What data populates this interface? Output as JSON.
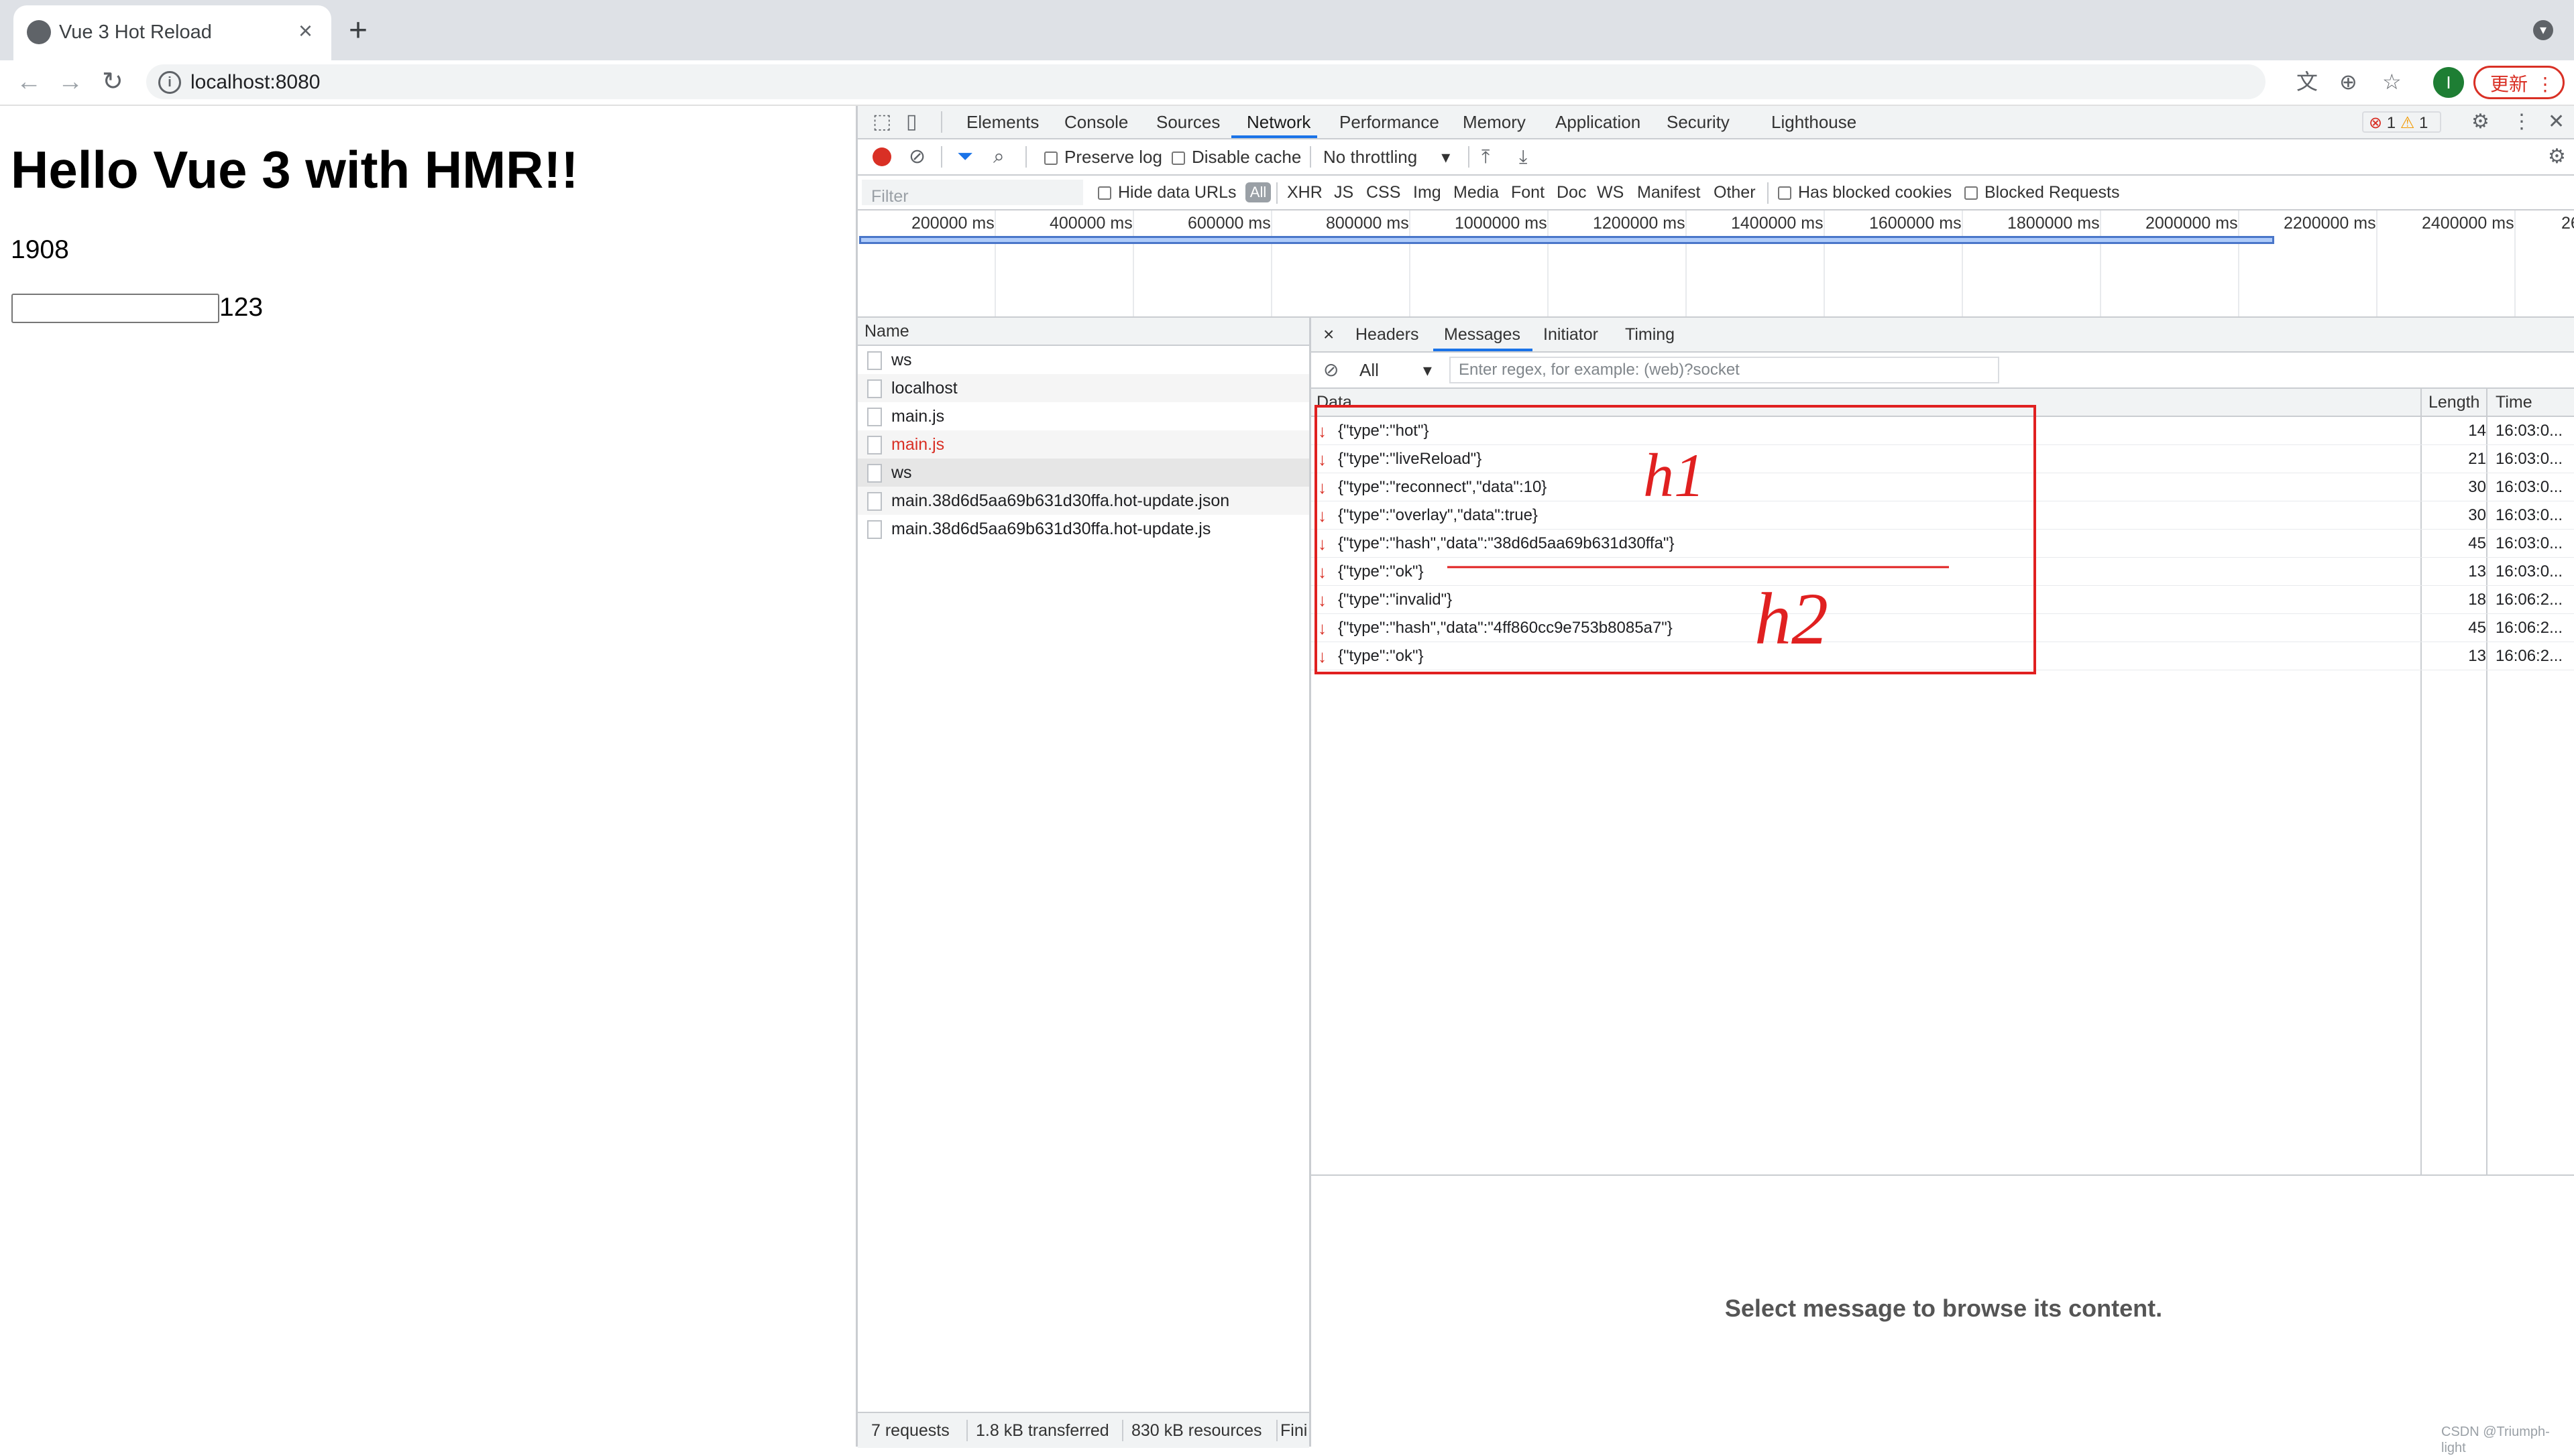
{
  "browser": {
    "tab_title": "Vue 3 Hot Reload",
    "tab_close": "×",
    "new_tab": "+",
    "url": "localhost:8080",
    "info_icon": "i",
    "back": "←",
    "forward": "→",
    "reload": "↻",
    "profile_initial": "I",
    "update_label": "更新",
    "menu_dots": "⋮",
    "translate_icon": "文",
    "zoom_icon": "⊕",
    "star_icon": "☆",
    "tab_search_icon": "▾"
  },
  "page": {
    "heading": "Hello Vue 3 with HMR!!",
    "counter": "1908",
    "input_value": "",
    "input_echo": "123"
  },
  "devtools": {
    "tabs": [
      "Elements",
      "Console",
      "Sources",
      "Network",
      "Performance",
      "Memory",
      "Application",
      "Security",
      "Lighthouse"
    ],
    "active_tab": "Network",
    "issues": {
      "errors": "1",
      "warnings": "1"
    },
    "network_toolbar": {
      "preserve_log": "Preserve log",
      "disable_cache": "Disable cache",
      "throttling": "No throttling"
    },
    "filter_bar": {
      "placeholder": "Filter",
      "hide_data_urls": "Hide data URLs",
      "types": [
        "All",
        "XHR",
        "JS",
        "CSS",
        "Img",
        "Media",
        "Font",
        "Doc",
        "WS",
        "Manifest",
        "Other"
      ],
      "has_blocked_cookies": "Has blocked cookies",
      "blocked_requests": "Blocked Requests"
    },
    "timeline_ticks": [
      "200000 ms",
      "400000 ms",
      "600000 ms",
      "800000 ms",
      "1000000 ms",
      "1200000 ms",
      "1400000 ms",
      "1600000 ms",
      "1800000 ms",
      "2000000 ms",
      "2200000 ms",
      "2400000 ms",
      "26"
    ],
    "requests": {
      "header": "Name",
      "rows": [
        {
          "name": "ws",
          "error": false
        },
        {
          "name": "localhost",
          "error": false
        },
        {
          "name": "main.js",
          "error": false
        },
        {
          "name": "main.js",
          "error": true
        },
        {
          "name": "ws",
          "error": false
        },
        {
          "name": "main.38d6d5aa69b631d30ffa.hot-update.json",
          "error": false
        },
        {
          "name": "main.38d6d5aa69b631d30ffa.hot-update.js",
          "error": false
        }
      ]
    },
    "status_bar": {
      "requests": "7 requests",
      "transferred": "1.8 kB transferred",
      "resources": "830 kB resources",
      "finish": "Finis"
    },
    "detail": {
      "close": "×",
      "tabs": [
        "Headers",
        "Messages",
        "Initiator",
        "Timing"
      ],
      "active_tab": "Messages",
      "message_filter": "All",
      "regex_placeholder": "Enter regex, for example: (web)?socket",
      "columns": {
        "data": "Data",
        "length": "Length",
        "time": "Time"
      },
      "messages": [
        {
          "data": "{\"type\":\"hot\"}",
          "length": "14",
          "time": "16:03:0..."
        },
        {
          "data": "{\"type\":\"liveReload\"}",
          "length": "21",
          "time": "16:03:0..."
        },
        {
          "data": "{\"type\":\"reconnect\",\"data\":10}",
          "length": "30",
          "time": "16:03:0..."
        },
        {
          "data": "{\"type\":\"overlay\",\"data\":true}",
          "length": "30",
          "time": "16:03:0..."
        },
        {
          "data": "{\"type\":\"hash\",\"data\":\"38d6d5aa69b631d30ffa\"}",
          "length": "45",
          "time": "16:03:0..."
        },
        {
          "data": "{\"type\":\"ok\"}",
          "length": "13",
          "time": "16:03:0..."
        },
        {
          "data": "{\"type\":\"invalid\"}",
          "length": "18",
          "time": "16:06:2..."
        },
        {
          "data": "{\"type\":\"hash\",\"data\":\"4ff860cc9e753b8085a7\"}",
          "length": "45",
          "time": "16:06:2..."
        },
        {
          "data": "{\"type\":\"ok\"}",
          "length": "13",
          "time": "16:06:2..."
        }
      ],
      "empty_message": "Select message to browse its content."
    }
  },
  "annotations": {
    "h1": "h1",
    "h2": "h2"
  },
  "watermark": "CSDN @Triumph-light",
  "colors": {
    "accent": "#1a73e8",
    "error": "#d93025",
    "annotation": "#e02020"
  }
}
